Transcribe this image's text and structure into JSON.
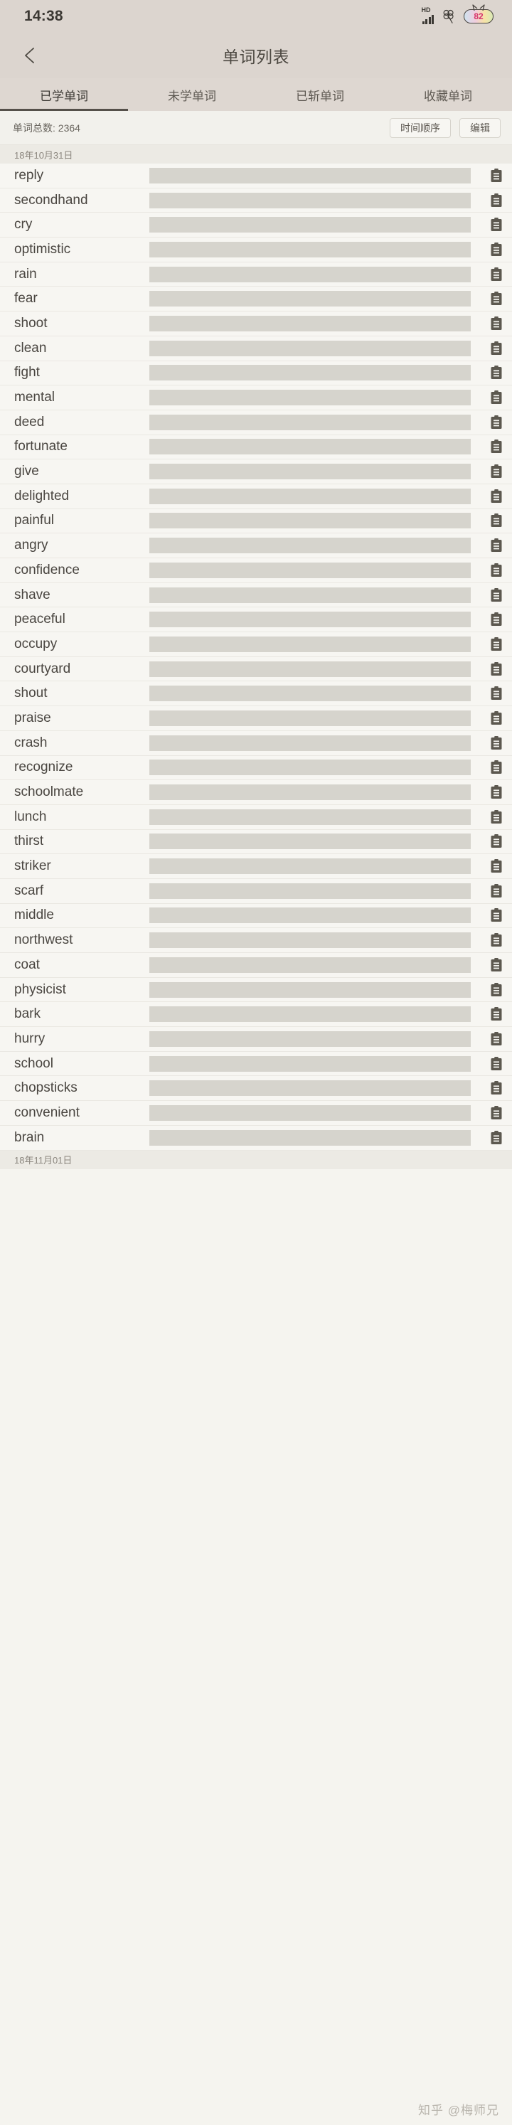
{
  "status_bar": {
    "time": "14:38",
    "network_label": "HD",
    "signal_icon": "signal-bars-icon",
    "clover_icon": "clover-icon",
    "battery_percent": "82",
    "battery_icon": "battery-icon"
  },
  "title_bar": {
    "back_icon": "back-arrow-icon",
    "title": "单词列表"
  },
  "tabs": [
    {
      "label": "已学单词",
      "active": true
    },
    {
      "label": "未学单词",
      "active": false
    },
    {
      "label": "已斩单词",
      "active": false
    },
    {
      "label": "收藏单词",
      "active": false
    }
  ],
  "toolbar": {
    "total_label": "单词总数: 2364",
    "total_count": "2364",
    "sort_label": "时间顺序",
    "edit_label": "编辑"
  },
  "colors": {
    "status_bg": "#dcd5cf",
    "tab_bg": "#ded7d1",
    "list_bg": "#f7f6f2",
    "redact_bar": "#d6d4cd",
    "text_primary": "#4a4641",
    "text_muted": "#8b867e",
    "accent_underline": "#55504a",
    "battery_text": "#d6356a"
  },
  "groups": [
    {
      "date": "18年10月31日",
      "words": [
        "reply",
        "secondhand",
        "cry",
        "optimistic",
        "rain",
        "fear",
        "shoot",
        "clean",
        "fight",
        "mental",
        "deed",
        "fortunate",
        "give",
        "delighted",
        "painful",
        "angry",
        "confidence",
        "shave",
        "peaceful",
        "occupy",
        "courtyard",
        "shout",
        "praise",
        "crash",
        "recognize",
        "schoolmate",
        "lunch",
        "thirst",
        "striker",
        "scarf",
        "middle",
        "northwest",
        "coat",
        "physicist",
        "bark",
        "hurry",
        "school",
        "chopsticks",
        "convenient",
        "brain"
      ]
    },
    {
      "date": "18年11月01日",
      "words": []
    }
  ],
  "row_icon": "clipboard-note-icon",
  "row_redaction": "hidden-definition-bar",
  "watermark": "知乎 @梅师兄"
}
